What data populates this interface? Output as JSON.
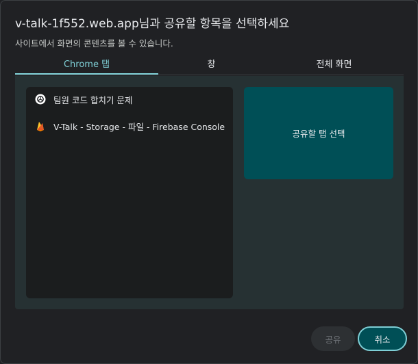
{
  "dialog": {
    "title": "v-talk-1f552.web.app님과 공유할 항목을 선택하세요",
    "subtitle": "사이트에서 화면의 콘텐츠를 볼 수 있습니다."
  },
  "tabs": [
    {
      "label": "Chrome 탭",
      "active": true
    },
    {
      "label": "창",
      "active": false
    },
    {
      "label": "전체 화면",
      "active": false
    }
  ],
  "tab_list": [
    {
      "label": "팀원 코드 합치기 문제",
      "icon": "openai-icon"
    },
    {
      "label": "V-Talk - Storage - 파일 - Firebase Console",
      "icon": "firebase-icon"
    }
  ],
  "preview": {
    "label": "공유할 탭 선택"
  },
  "buttons": {
    "share": "공유",
    "cancel": "취소"
  },
  "colors": {
    "accent": "#7fcfd6",
    "preview_bg": "#004f56",
    "panel_bg": "#263133"
  }
}
